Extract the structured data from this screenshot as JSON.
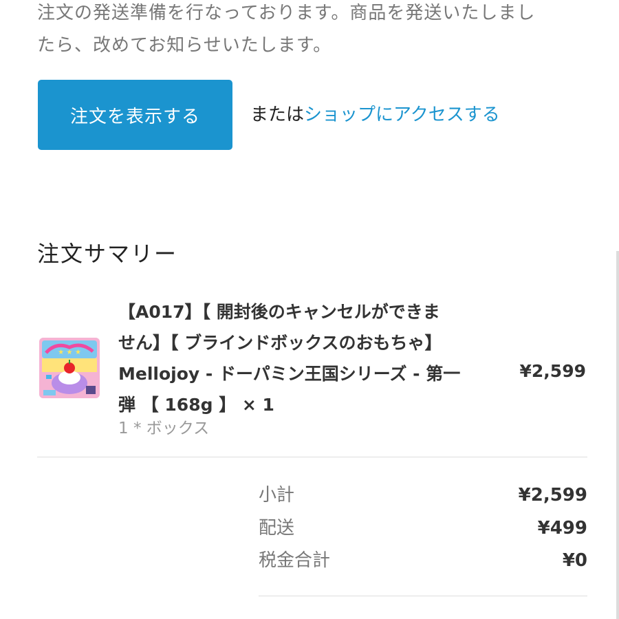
{
  "notice": {
    "line1": "注文の発送準備を行なっております。商品を発送いたしまし",
    "line2": "たら、改めてお知らせいたします。"
  },
  "actions": {
    "view_order_label": "注文を表示する",
    "or_text": "または",
    "shop_link_label": "ショップにアクセスする"
  },
  "summary": {
    "title": "注文サマリー",
    "items": [
      {
        "name_lines": [
          "【A017】【 開封後のキャンセルができま",
          "せん】【 ブラインドボックスのおもちゃ】",
          "Mellojoy - ドーパミン王国シリーズ - 第一",
          "弾 【 168g 】 × 1"
        ],
        "variant": "1 * ボックス",
        "price": "¥2,599"
      }
    ],
    "totals": [
      {
        "label": "小計",
        "value": "¥2,599"
      },
      {
        "label": "配送",
        "value": "¥499"
      },
      {
        "label": "税金合計",
        "value": "¥0"
      }
    ]
  },
  "colors": {
    "accent": "#1b94cf",
    "muted_text": "#777777",
    "divider": "#dddddd"
  }
}
